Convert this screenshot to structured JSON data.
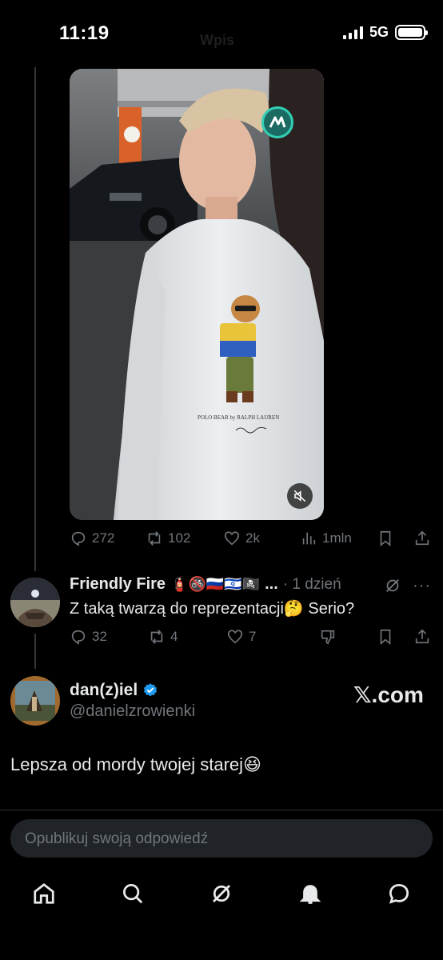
{
  "status_bar": {
    "time": "11:19",
    "network": "5G",
    "title_ghost": "Wpis"
  },
  "main_tweet_stats": {
    "replies": "272",
    "reposts": "102",
    "likes": "2k",
    "views": "1mln"
  },
  "video": {
    "badge_icon": "m-logo-icon",
    "muted": true,
    "shirt_text": "POLO BEAR by RALPH LAUREN"
  },
  "reply": {
    "name": "Friendly Fire",
    "emojis": "🧯🚳🇷🇺🇮🇱🏴‍☠️",
    "ellipsis": "...",
    "time": "· 1 dzień",
    "text": "Z taką twarzą do reprezentacji🤔 Serio?",
    "replies": "32",
    "reposts": "4",
    "likes": "7"
  },
  "author": {
    "name": "dan(z)iel",
    "verified": true,
    "handle": "@danielzrowienki",
    "watermark": "𝕏.com",
    "body": "Lepsza od mordy twojej starej😆"
  },
  "reply_box": {
    "placeholder": "Opublikuj swoją odpowiedź"
  },
  "tabs": [
    "home",
    "search",
    "grok",
    "notifications",
    "messages"
  ],
  "colors": {
    "background": "#000000",
    "muted": "#71767b",
    "verified": "#1d9bf0",
    "badge": "#31d0b5"
  }
}
